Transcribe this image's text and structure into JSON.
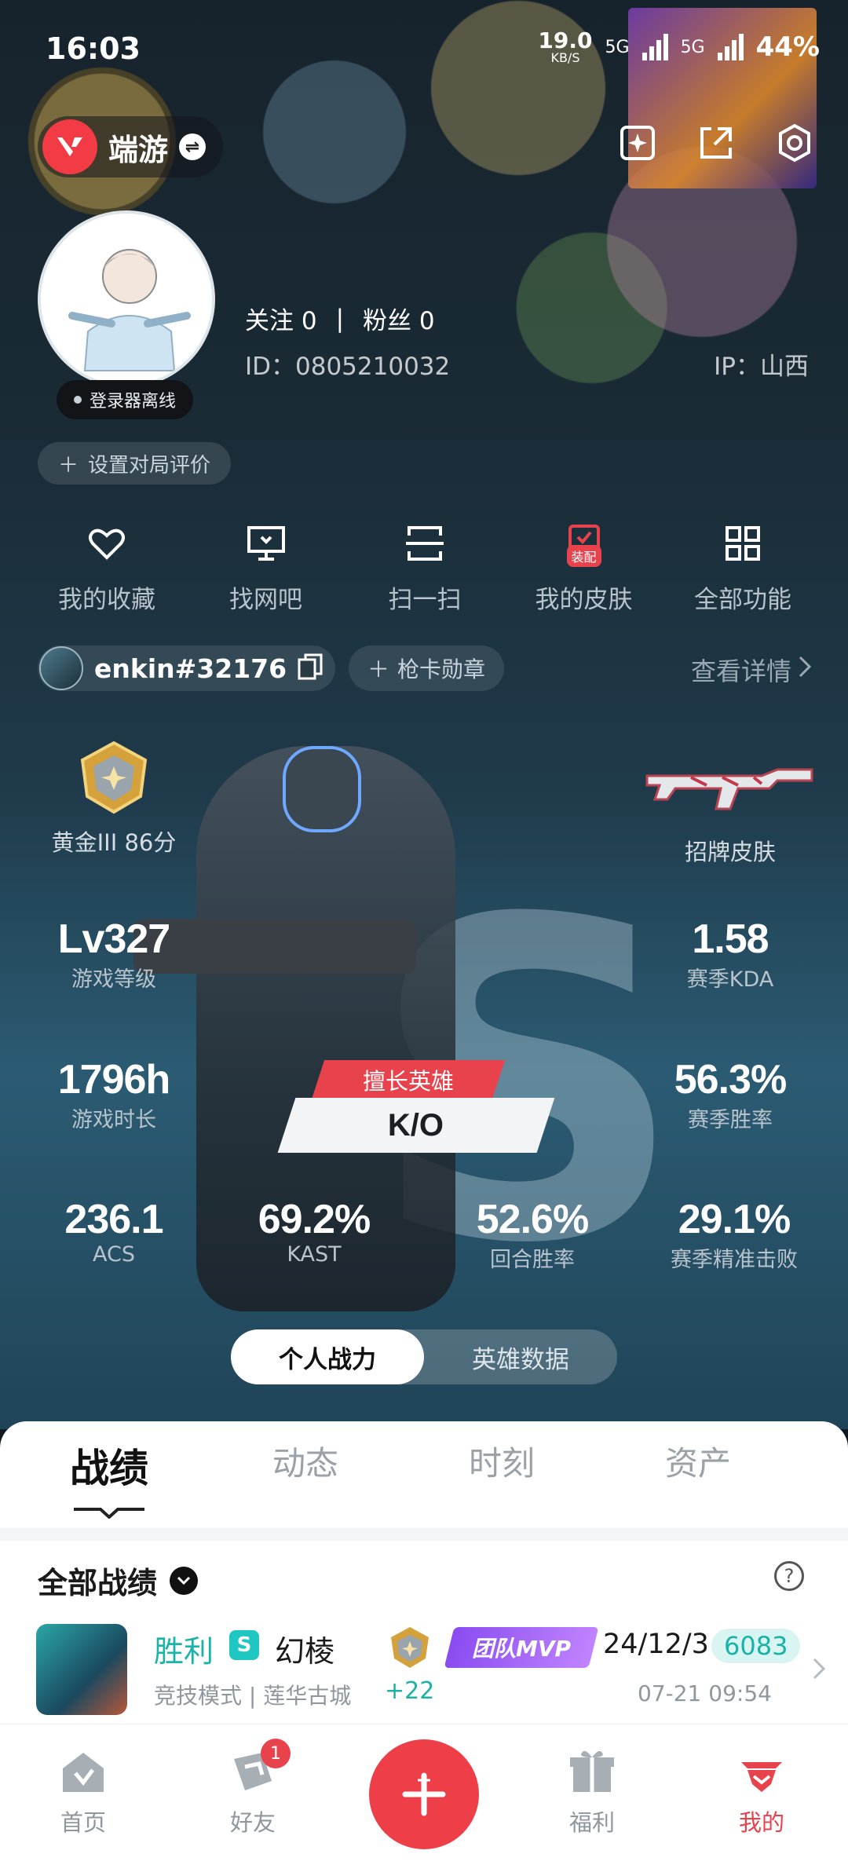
{
  "status_bar": {
    "time": "16:03",
    "net_speed_value": "19.0",
    "net_speed_unit": "KB/S",
    "network_label_1": "5G",
    "network_label_2": "5G",
    "battery": "44%"
  },
  "app": {
    "name": "端游",
    "logo_icon": "valorant-logo-icon",
    "accent_color": "#e8434d"
  },
  "profile": {
    "avatar_icon": "user-avatar",
    "login_status": "登录器离线",
    "follow_label": "关注",
    "follow_count": "0",
    "separator": "|",
    "fans_label": "粉丝",
    "fans_count": "0",
    "id_text": "ID：0805210032",
    "ip_text": "IP：山西",
    "rate_button": "设置对局评价"
  },
  "quick_actions": [
    {
      "label": "我的收藏",
      "icon": "heart-icon"
    },
    {
      "label": "找网吧",
      "icon": "monitor-icon"
    },
    {
      "label": "扫一扫",
      "icon": "scan-icon"
    },
    {
      "label": "我的皮肤",
      "icon": "skin-icon",
      "badge": "装配"
    },
    {
      "label": "全部功能",
      "icon": "grid-icon"
    }
  ],
  "account": {
    "riot_id": "enkin#32176",
    "badge_button": "枪卡勋章",
    "details_link": "查看详情"
  },
  "stats": {
    "rank_label": "黄金III 86分",
    "skin_label": "招牌皮肤",
    "level_value": "Lv327",
    "level_label": "游戏等级",
    "kda_value": "1.58",
    "kda_label": "赛季KDA",
    "hours_value": "1796h",
    "hours_label": "游戏时长",
    "winrate_value": "56.3%",
    "winrate_label": "赛季胜率",
    "acs_value": "236.1",
    "acs_label": "ACS",
    "kast_value": "69.2%",
    "kast_label": "KAST",
    "round_win_value": "52.6%",
    "round_win_label": "回合胜率",
    "precise_value": "29.1%",
    "precise_label": "赛季精准击败",
    "main_agent_tag": "擅长英雄",
    "main_agent_name": "K/O"
  },
  "segment": {
    "personal": "个人战力",
    "agents": "英雄数据"
  },
  "tabs": [
    "战绩",
    "动态",
    "时刻",
    "资产"
  ],
  "records": {
    "filter_label": "全部战绩",
    "matches": [
      {
        "result": "胜利",
        "mode_badge": "S",
        "map": "幻棱",
        "mode_line": "竞技模式 | 莲华古城",
        "rr_delta": "+22",
        "mvp": "团队MVP",
        "date": "24/12/3",
        "score": "6083",
        "time": "07-21 09:54"
      }
    ]
  },
  "bottom_nav": {
    "home": "首页",
    "friends": "好友",
    "friends_badge": "1",
    "welfare": "福利",
    "me": "我的"
  }
}
